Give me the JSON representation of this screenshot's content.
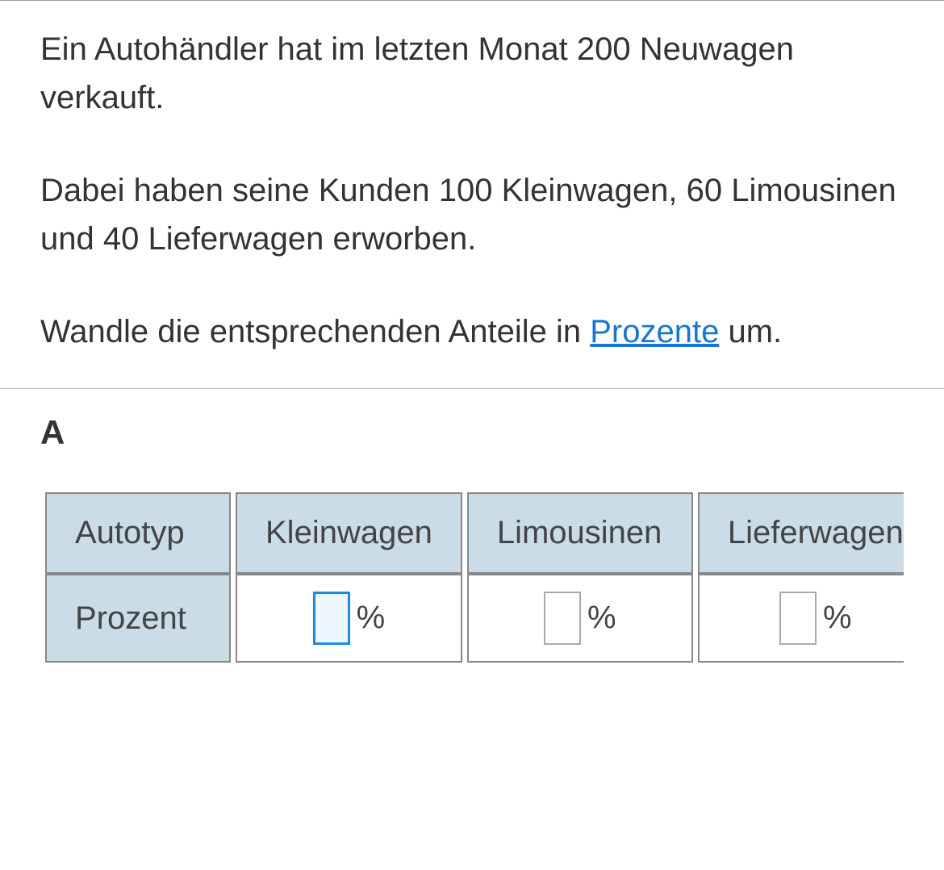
{
  "problem": {
    "paragraph1": "Ein Autohändler hat im letzten Monat 200 Neuwagen verkauft.",
    "paragraph2": "Dabei haben seine Kunden 100 Kleinwagen, 60 Limousinen und 40 Lieferwagen erworben.",
    "paragraph3_prefix": "Wandle die entsprechenden Anteile in ",
    "paragraph3_link": "Prozente",
    "paragraph3_suffix": " um."
  },
  "section_label": "A",
  "table": {
    "row1_label": "Autotyp",
    "row2_label": "Prozent",
    "columns": [
      {
        "header": "Kleinwagen",
        "value": "",
        "unit": "%",
        "active": true
      },
      {
        "header": "Limousinen",
        "value": "",
        "unit": "%",
        "active": false
      },
      {
        "header": "Lieferwagen",
        "value": "",
        "unit": "%",
        "active": false
      }
    ]
  }
}
